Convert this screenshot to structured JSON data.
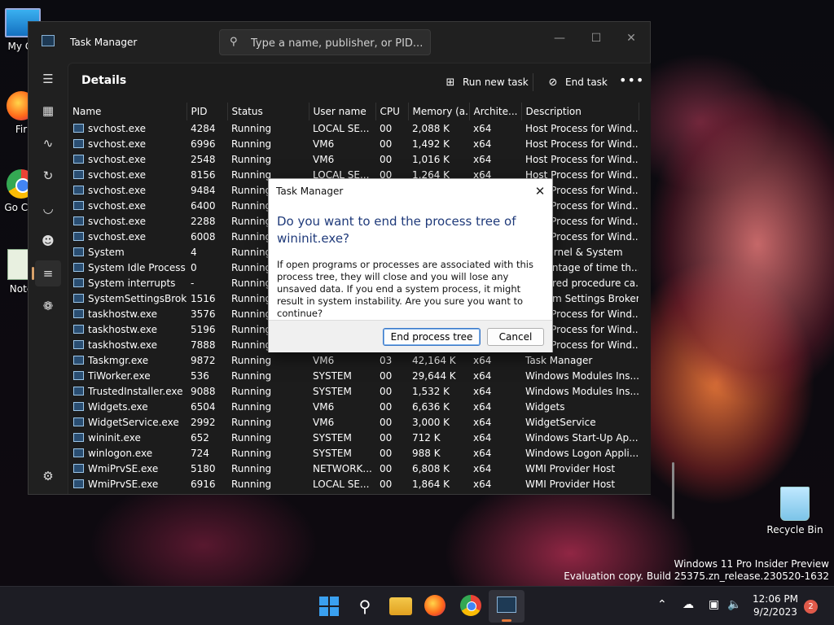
{
  "desktop": {
    "icons": [
      {
        "label": "My Co"
      },
      {
        "label": "Fir"
      },
      {
        "label": "Go Chr"
      },
      {
        "label": "Note"
      },
      {
        "label": "Recycle Bin"
      }
    ],
    "watermark_line1": "Windows 11 Pro Insider Preview",
    "watermark_line2": "Evaluation copy. Build 25375.zn_release.230520-1632"
  },
  "window": {
    "title": "Task Manager",
    "search_placeholder": "Type a name, publisher, or PID...",
    "page_title": "Details",
    "run_new_task": "Run new task",
    "end_task": "End task",
    "more": "•••"
  },
  "table": {
    "columns": [
      "Name",
      "PID",
      "Status",
      "User name",
      "CPU",
      "Memory (a...",
      "Archite...",
      "Description"
    ],
    "rows": [
      [
        "svchost.exe",
        "4284",
        "Running",
        "LOCAL SE...",
        "00",
        "2,088 K",
        "x64",
        "Host Process for Wind..."
      ],
      [
        "svchost.exe",
        "6996",
        "Running",
        "VM6",
        "00",
        "1,492 K",
        "x64",
        "Host Process for Wind..."
      ],
      [
        "svchost.exe",
        "2548",
        "Running",
        "VM6",
        "00",
        "1,016 K",
        "x64",
        "Host Process for Wind..."
      ],
      [
        "svchost.exe",
        "8156",
        "Running",
        "LOCAL SE...",
        "00",
        "1,264 K",
        "x64",
        "Host Process for Wind..."
      ],
      [
        "svchost.exe",
        "9484",
        "Running",
        "",
        "",
        "",
        "",
        "Host Process for Wind..."
      ],
      [
        "svchost.exe",
        "6400",
        "Running",
        "",
        "",
        "",
        "",
        "Host Process for Wind..."
      ],
      [
        "svchost.exe",
        "2288",
        "Running",
        "",
        "",
        "",
        "",
        "Host Process for Wind..."
      ],
      [
        "svchost.exe",
        "6008",
        "Running",
        "",
        "",
        "",
        "",
        "Host Process for Wind..."
      ],
      [
        "System",
        "4",
        "Running",
        "",
        "",
        "",
        "",
        "NT Kernel & System"
      ],
      [
        "System Idle Process",
        "0",
        "Running",
        "",
        "",
        "",
        "",
        "Percentage of time th..."
      ],
      [
        "System interrupts",
        "-",
        "Running",
        "",
        "",
        "",
        "",
        "Deferred procedure ca..."
      ],
      [
        "SystemSettingsBroke...",
        "1516",
        "Running",
        "",
        "",
        "",
        "",
        "System Settings Broker"
      ],
      [
        "taskhostw.exe",
        "3576",
        "Running",
        "",
        "",
        "",
        "",
        "Host Process for Wind..."
      ],
      [
        "taskhostw.exe",
        "5196",
        "Running",
        "",
        "",
        "",
        "",
        "Host Process for Wind..."
      ],
      [
        "taskhostw.exe",
        "7888",
        "Running",
        "",
        "",
        "",
        "",
        "Host Process for Wind..."
      ],
      [
        "Taskmgr.exe",
        "9872",
        "Running",
        "VM6",
        "03",
        "42,164 K",
        "x64",
        "Task Manager"
      ],
      [
        "TiWorker.exe",
        "536",
        "Running",
        "SYSTEM",
        "00",
        "29,644 K",
        "x64",
        "Windows Modules Ins..."
      ],
      [
        "TrustedInstaller.exe",
        "9088",
        "Running",
        "SYSTEM",
        "00",
        "1,532 K",
        "x64",
        "Windows Modules Ins..."
      ],
      [
        "Widgets.exe",
        "6504",
        "Running",
        "VM6",
        "00",
        "6,636 K",
        "x64",
        "Widgets"
      ],
      [
        "WidgetService.exe",
        "2992",
        "Running",
        "VM6",
        "00",
        "3,000 K",
        "x64",
        "WidgetService"
      ],
      [
        "wininit.exe",
        "652",
        "Running",
        "SYSTEM",
        "00",
        "712 K",
        "x64",
        "Windows Start-Up Ap..."
      ],
      [
        "winlogon.exe",
        "724",
        "Running",
        "SYSTEM",
        "00",
        "988 K",
        "x64",
        "Windows Logon Appli..."
      ],
      [
        "WmiPrvSE.exe",
        "5180",
        "Running",
        "NETWORK...",
        "00",
        "6,808 K",
        "x64",
        "WMI Provider Host"
      ],
      [
        "WmiPrvSE.exe",
        "6916",
        "Running",
        "LOCAL SE...",
        "00",
        "1,864 K",
        "x64",
        "WMI Provider Host"
      ]
    ]
  },
  "dialog": {
    "title": "Task Manager",
    "close": "✕",
    "heading": "Do you want to end the process tree of wininit.exe?",
    "body": "If open programs or processes are associated with this process tree, they will close and you will lose any unsaved data. If you end a system process, it might result in system instability. Are you sure you want to continue?",
    "primary_button": "End process tree",
    "cancel_button": "Cancel"
  },
  "taskbar": {
    "time": "12:06 PM",
    "date": "9/2/2023",
    "notification_count": "2"
  }
}
